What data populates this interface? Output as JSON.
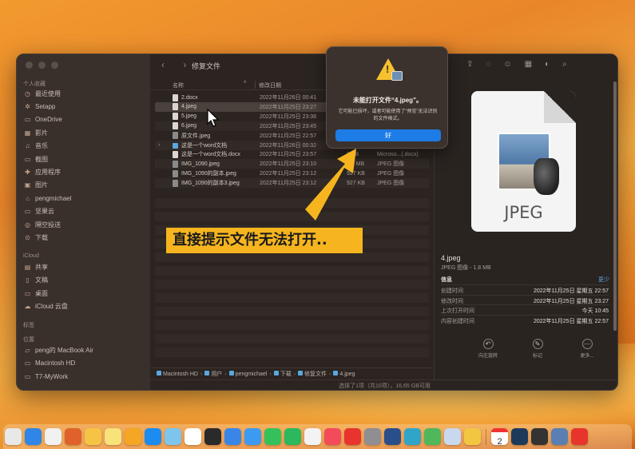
{
  "window": {
    "title": "修复文件",
    "nav_arrows": "‹  ›"
  },
  "sidebar": {
    "sections": {
      "favorites": "个人收藏",
      "icloud": "iCloud",
      "tags": "标签",
      "locations": "位置"
    },
    "favorites": [
      {
        "label": "最近使用",
        "icon": "clock-icon"
      },
      {
        "label": "Setapp",
        "icon": "setapp-icon"
      },
      {
        "label": "OneDrive",
        "icon": "folder-icon"
      },
      {
        "label": "影片",
        "icon": "film-icon"
      },
      {
        "label": "音乐",
        "icon": "music-icon"
      },
      {
        "label": "截图",
        "icon": "folder-icon"
      },
      {
        "label": "应用程序",
        "icon": "apps-icon"
      },
      {
        "label": "图片",
        "icon": "photo-icon"
      },
      {
        "label": "pengmichael",
        "icon": "home-icon"
      },
      {
        "label": "坚果云",
        "icon": "folder-icon"
      },
      {
        "label": "隔空投送",
        "icon": "airdrop-icon"
      },
      {
        "label": "下载",
        "icon": "download-icon"
      }
    ],
    "icloud_items": [
      {
        "label": "共享",
        "icon": "shared-icon"
      },
      {
        "label": "文稿",
        "icon": "doc-icon"
      },
      {
        "label": "桌面",
        "icon": "desktop-icon"
      },
      {
        "label": "iCloud 云盘",
        "icon": "cloud-icon"
      }
    ],
    "locations": [
      {
        "label": "peng的 MacBook Air",
        "icon": "laptop-icon"
      },
      {
        "label": "Macintosh HD",
        "icon": "disk-icon"
      },
      {
        "label": "T7-MyWork",
        "icon": "disk-icon"
      }
    ]
  },
  "list": {
    "header_name": "名称",
    "header_date": "修改日期",
    "sort_indicator": "^",
    "files": [
      {
        "name": "2.docx",
        "date": "2022年11月26日 00:41",
        "size": "",
        "kind": "",
        "type": "doc"
      },
      {
        "name": "4.jpeg",
        "date": "2022年11月25日 23:27",
        "size": "",
        "kind": "",
        "type": "doc",
        "selected": true
      },
      {
        "name": "5.jpeg",
        "date": "2022年11月25日 23:36",
        "size": "",
        "kind": "",
        "type": "doc"
      },
      {
        "name": "6.jpeg",
        "date": "2022年11月25日 23:45",
        "size": "",
        "kind": "",
        "type": "doc"
      },
      {
        "name": "原文件.jpeg",
        "date": "2022年11月25日 22:57",
        "size": "",
        "kind": "",
        "type": "img"
      },
      {
        "name": "这是一个word文档",
        "date": "2022年11月26日 00:32",
        "size": "",
        "kind": "",
        "type": "folder",
        "disclose": "›"
      },
      {
        "name": "这是一个word文档.docx",
        "date": "2022年11月25日 23:57",
        "size": "0 KB",
        "kind": "Microso...(.docx)",
        "type": "doc"
      },
      {
        "name": "IMG_1090.jpeg",
        "date": "2022年11月25日 23:10",
        "size": "1.8 MB",
        "kind": "JPEG 图像",
        "type": "img"
      },
      {
        "name": "IMG_1090的副本.jpeg",
        "date": "2022年11月25日 23:12",
        "size": "927 KB",
        "kind": "JPEG 图像",
        "type": "img"
      },
      {
        "name": "IMG_1090的副本3.jpeg",
        "date": "2022年11月25日 23:12",
        "size": "927 KB",
        "kind": "JPEG 图像",
        "type": "img"
      }
    ]
  },
  "pathbar": [
    "Macintosh HD",
    "用户",
    "pengmichael",
    "下载",
    "修复文件",
    "4.jpeg"
  ],
  "statusbar": "选择了1项（共10项），16.65 GB可用",
  "preview": {
    "doc_label": "JPEG",
    "file_name": "4.jpeg",
    "file_sub": "JPEG 图像 - 1.8 MB",
    "info_heading": "信息",
    "less_link": "更少",
    "rows": [
      {
        "k": "创建时间",
        "v": "2022年11月25日 星期五 22:57"
      },
      {
        "k": "修改时间",
        "v": "2022年11月25日 星期五 23:27"
      },
      {
        "k": "上次打开时间",
        "v": "今天 10:45"
      },
      {
        "k": "内容创建时间",
        "v": "2022年11月25日 星期五 22:57"
      }
    ],
    "actions": [
      {
        "label": "向左旋转",
        "icon": "rotate-left-icon",
        "glyph": "↶"
      },
      {
        "label": "标记",
        "icon": "markup-icon",
        "glyph": "✎"
      },
      {
        "label": "更多...",
        "icon": "more-icon",
        "glyph": "⋯"
      }
    ]
  },
  "dialog": {
    "title": "未能打开文件“4.jpeg”。",
    "message": "它可能已损坏，或者可能使用了“预览”无法识别的文件格式。",
    "ok_label": "好"
  },
  "annotation": {
    "callout": "直接提示文件无法打开.."
  },
  "dock": {
    "calendar_day": "2",
    "apps": [
      {
        "name": "launchpad",
        "color": "#e8e8e8"
      },
      {
        "name": "safari",
        "color": "#2f86e6"
      },
      {
        "name": "chrome",
        "color": "#f1f1f1"
      },
      {
        "name": "firefox",
        "color": "#e0622a"
      },
      {
        "name": "photos",
        "color": "#f6c444"
      },
      {
        "name": "notes",
        "color": "#f8e27a"
      },
      {
        "name": "pages",
        "color": "#f5a623"
      },
      {
        "name": "app-store",
        "color": "#1c8cf0"
      },
      {
        "name": "finder",
        "color": "#7ec5ee"
      },
      {
        "name": "notion",
        "color": "#ffffff"
      },
      {
        "name": "terminal",
        "color": "#2a2a2a"
      },
      {
        "name": "testflight",
        "color": "#3a86e8"
      },
      {
        "name": "mail",
        "color": "#3d9af2"
      },
      {
        "name": "wechat",
        "color": "#35c15a"
      },
      {
        "name": "wechat-work",
        "color": "#2cb85c"
      },
      {
        "name": "reminders",
        "color": "#f3f3f3"
      },
      {
        "name": "music",
        "color": "#f44b5a"
      },
      {
        "name": "netease",
        "color": "#e8332f"
      },
      {
        "name": "settings",
        "color": "#8e8e93"
      },
      {
        "name": "quicktime",
        "color": "#2a4e8a"
      },
      {
        "name": "edge",
        "color": "#2fa5c8"
      },
      {
        "name": "maps",
        "color": "#4fb85a"
      },
      {
        "name": "preview",
        "color": "#c9d8ee"
      },
      {
        "name": "font-app",
        "color": "#f3c642"
      },
      {
        "name": "calendar",
        "color": "#ffffff"
      },
      {
        "name": "steam",
        "color": "#1d3a5c"
      },
      {
        "name": "claquette",
        "color": "#333333"
      },
      {
        "name": "screens",
        "color": "#5a7fb3"
      },
      {
        "name": "wps",
        "color": "#e7352b"
      }
    ]
  }
}
